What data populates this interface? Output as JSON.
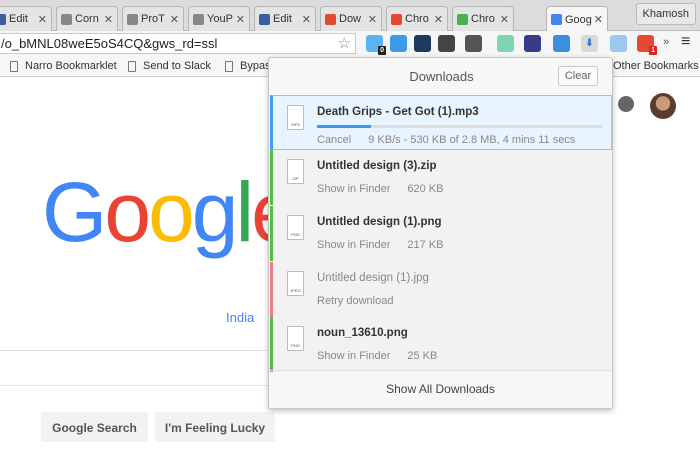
{
  "tabs": [
    {
      "title": "Edit",
      "favicon_color": "#3a5f9c"
    },
    {
      "title": "Corn",
      "favicon_color": "#888888"
    },
    {
      "title": "ProT",
      "favicon_color": "#888888"
    },
    {
      "title": "YouP",
      "favicon_color": "#888888"
    },
    {
      "title": "Edit",
      "favicon_color": "#3a5f9c"
    },
    {
      "title": "Dow",
      "favicon_color": "#e44a32"
    },
    {
      "title": "Chro",
      "favicon_color": "#e44a32"
    },
    {
      "title": "Chro",
      "favicon_color": "#4caf50"
    },
    {
      "title": "Goog",
      "favicon_color": "#4285f4",
      "active": true
    }
  ],
  "profile": "Khamosh",
  "omnibox": {
    "url": "/o_bMNL08weE5oS4CQ&gws_rd=ssl"
  },
  "extensions": [
    {
      "icon": "ghostery-icon",
      "color": "#5bb3f0",
      "badge": "0"
    },
    {
      "icon": "camera-icon",
      "color": "#3c9be8"
    },
    {
      "icon": "m-shield-icon",
      "color": "#1e3a5f"
    },
    {
      "icon": "circle-d-icon",
      "color": "#444444"
    },
    {
      "icon": "plug-icon",
      "color": "#555555"
    },
    {
      "icon": "sound-wave-icon",
      "color": "#7ed6b0"
    },
    {
      "icon": "n-icon",
      "color": "#3a3a8a"
    },
    {
      "icon": "shield-v-icon",
      "color": "#3c8fe0"
    },
    {
      "icon": "download-icon",
      "color": "#2a7fe0"
    },
    {
      "icon": "page-icon",
      "color": "#9cc8f0"
    },
    {
      "icon": "download-badge-icon",
      "color": "#e44a32",
      "badge": "1"
    }
  ],
  "bookmarks": [
    "Narro Bookmarklet",
    "Send to Slack",
    "Bypas"
  ],
  "other_bookmarks": "Other Bookmarks",
  "google": {
    "logo": "Google",
    "region": "India",
    "search_button": "Google Search",
    "lucky_button": "I'm Feeling Lucky"
  },
  "downloads": {
    "title": "Downloads",
    "clear": "Clear",
    "show_all": "Show All Downloads",
    "items": [
      {
        "name": "Death Grips - Get Got (1).mp3",
        "type": "MP3",
        "action": "Cancel",
        "status": "9 KB/s - 530 KB of 2.8 MB, 4 mins 11 secs",
        "progress_percent": 19,
        "state": "in-progress"
      },
      {
        "name": "Untitled design (3).zip",
        "type": "ZIP",
        "action": "Show in Finder",
        "status": "620 KB",
        "state": "complete"
      },
      {
        "name": "Untitled design (1).png",
        "type": "PNG",
        "action": "Show in Finder",
        "status": "217 KB",
        "state": "complete"
      },
      {
        "name": "Untitled design (1).jpg",
        "type": "JPEG",
        "action": "Retry download",
        "status": "",
        "state": "failed"
      },
      {
        "name": "noun_13610.png",
        "type": "PNG",
        "action": "Show in Finder",
        "status": "25 KB",
        "state": "complete"
      }
    ]
  }
}
